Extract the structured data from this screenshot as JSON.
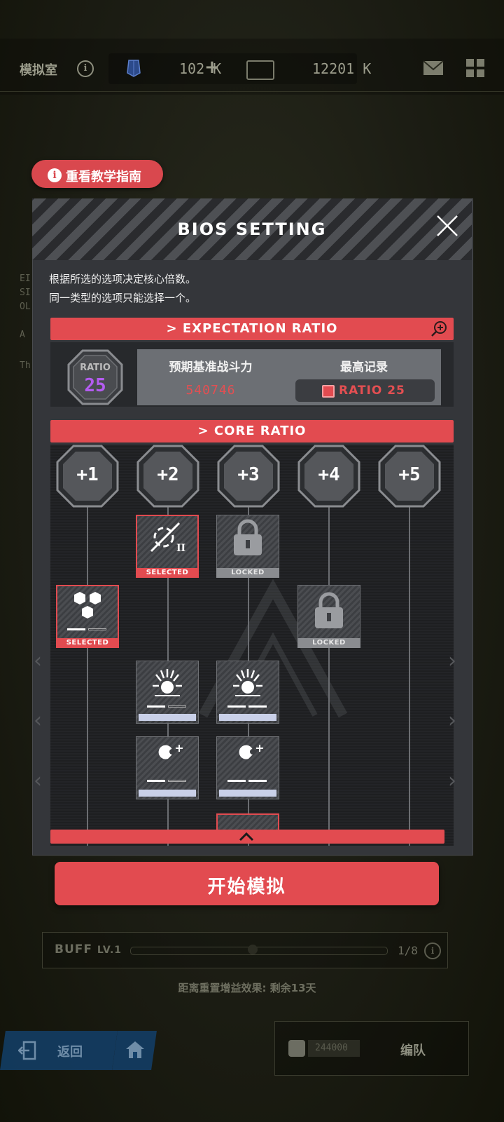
{
  "topbar": {
    "title": "模拟室",
    "info_icon": "info-icon",
    "resource1": "102 K",
    "resource1_plus": "+",
    "resource2": "12201 K"
  },
  "background": {
    "side_texts": [
      "EI",
      "SI",
      "OL",
      "A",
      "Th"
    ]
  },
  "tutorial": {
    "label": "重看教学指南"
  },
  "panel": {
    "title": "BIOS SETTING",
    "desc_line1": "根据所选的选项决定核心倍数。",
    "desc_line2": "同一类型的选项只能选择一个。",
    "expectation_bar": "> EXPECTATION RATIO",
    "ratio_label": "RATIO",
    "ratio_value": "25",
    "cp_label": "预期基准战斗力",
    "cp_value": "540746",
    "record_label": "最高记录",
    "record_value": "RATIO 25",
    "core_bar": "> CORE RATIO",
    "columns": [
      "+1",
      "+2",
      "+3",
      "+4",
      "+5"
    ],
    "tag_selected": "SELECTED",
    "tag_locked": "LOCKED",
    "node_roman": "II"
  },
  "start": {
    "label": "开始模拟"
  },
  "buff": {
    "label": "BUFF",
    "level": "LV.1",
    "count": "1/8",
    "reset_text": "距离重置增益效果: 剩余13天"
  },
  "bottom": {
    "back_label": "返回",
    "team_value": "244000",
    "team_label": "编队"
  },
  "colors": {
    "accent_red": "#e24b50",
    "ratio_purple": "#b45cf0",
    "panel_bg": "#34363a"
  }
}
